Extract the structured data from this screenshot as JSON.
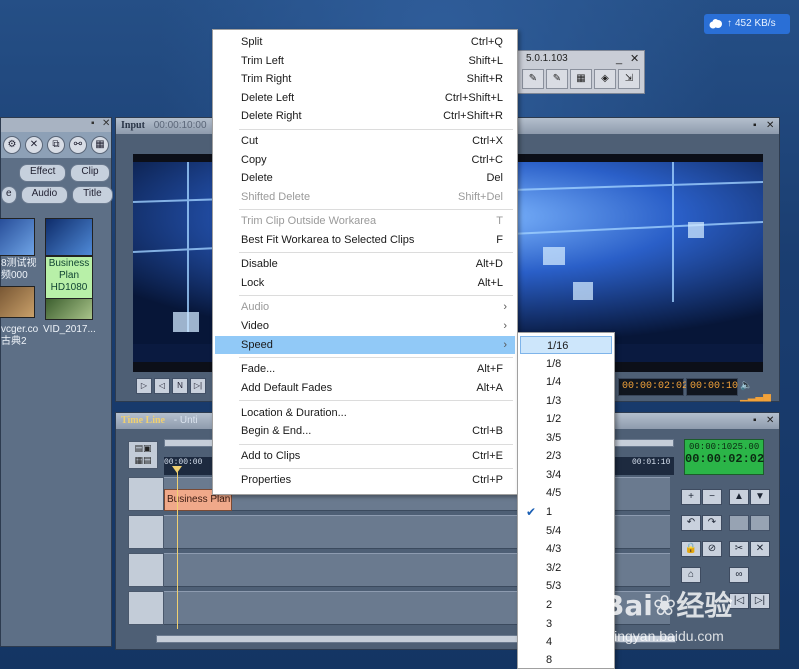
{
  "network": {
    "speed": "452 KB/s"
  },
  "mini_window": {
    "version": "5.0.1.103"
  },
  "library": {
    "tabs_row1": [
      "Effect",
      "Clip"
    ],
    "tabs_row2": [
      "e",
      "Audio",
      "Title"
    ],
    "thumbs": [
      {
        "label": "8测试视\n频000"
      },
      {
        "label": "Business\nPlan\nHD1080"
      },
      {
        "label": "vcger.co\n古典2"
      },
      {
        "label": "VID_2017..."
      }
    ]
  },
  "input_panel": {
    "title": "Input",
    "timecode_head": "00:00:10:00",
    "tc_current": "00:00:02:02",
    "tc_duration": "00:00:10"
  },
  "timeline": {
    "title": "Time Line",
    "subtitle": "- Unti",
    "ruler_start": "00:00:00",
    "ruler_end": "00:01:10",
    "clip_label": "Business Plan",
    "right_tc_top_left": "00:00:10",
    "right_tc_top_right": "25.00",
    "right_tc_main": "00:00:02:02"
  },
  "context_menu": {
    "items": [
      {
        "label": "Split",
        "shortcut": "Ctrl+Q"
      },
      {
        "label": "Trim Left",
        "shortcut": "Shift+L"
      },
      {
        "label": "Trim Right",
        "shortcut": "Shift+R"
      },
      {
        "label": "Delete Left",
        "shortcut": "Ctrl+Shift+L"
      },
      {
        "label": "Delete Right",
        "shortcut": "Ctrl+Shift+R"
      },
      {
        "label": "Cut",
        "shortcut": "Ctrl+X"
      },
      {
        "label": "Copy",
        "shortcut": "Ctrl+C"
      },
      {
        "label": "Delete",
        "shortcut": "Del"
      },
      {
        "label": "Shifted Delete",
        "shortcut": "Shift+Del"
      },
      {
        "label": "Trim Clip Outside Workarea",
        "shortcut": "T"
      },
      {
        "label": "Best Fit Workarea to Selected Clips",
        "shortcut": "F"
      },
      {
        "label": "Disable",
        "shortcut": "Alt+D"
      },
      {
        "label": "Lock",
        "shortcut": "Alt+L"
      },
      {
        "label": "Audio",
        "shortcut": ""
      },
      {
        "label": "Video",
        "shortcut": ""
      },
      {
        "label": "Speed",
        "shortcut": ""
      },
      {
        "label": "Fade...",
        "shortcut": "Alt+F"
      },
      {
        "label": "Add Default Fades",
        "shortcut": "Alt+A"
      },
      {
        "label": "Location & Duration...",
        "shortcut": ""
      },
      {
        "label": "Begin & End...",
        "shortcut": "Ctrl+B"
      },
      {
        "label": "Add to Clips",
        "shortcut": "Ctrl+E"
      },
      {
        "label": "Properties",
        "shortcut": "Ctrl+P"
      }
    ]
  },
  "speed_menu": {
    "items": [
      "1/16",
      "1/8",
      "1/4",
      "1/3",
      "1/2",
      "3/5",
      "2/3",
      "3/4",
      "4/5",
      "1",
      "5/4",
      "4/3",
      "3/2",
      "5/3",
      "2",
      "3",
      "4",
      "8"
    ],
    "checked": "1",
    "highlighted": "1/16"
  },
  "watermark": {
    "brand": "Bai",
    "brand2": "经验",
    "url": "jingyan.baidu.com"
  }
}
